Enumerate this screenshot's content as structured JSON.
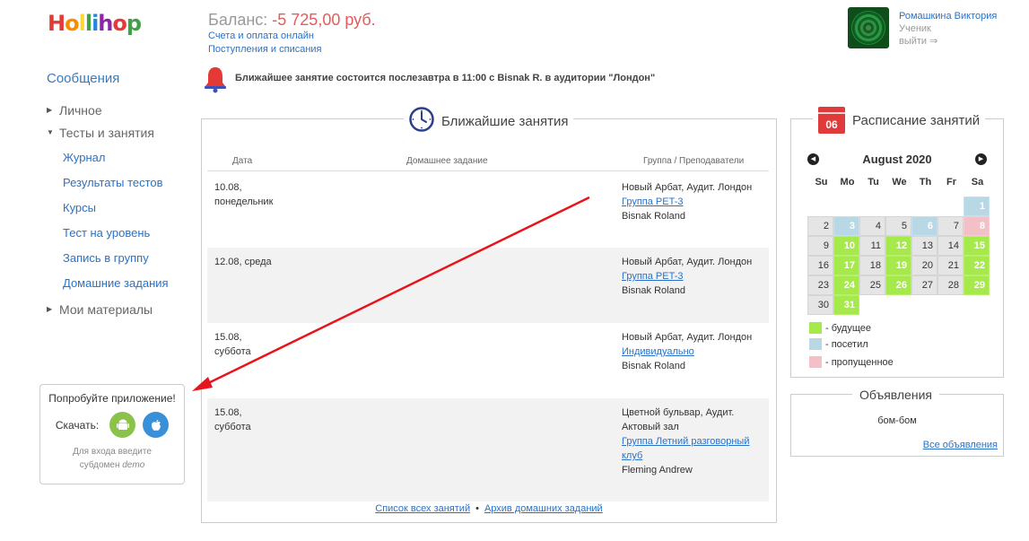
{
  "logo": {
    "letters": [
      "H",
      "o",
      "l",
      "l",
      "i",
      "h",
      "o",
      "p"
    ],
    "colors": [
      "#e53935",
      "#fb8c00",
      "#fdd835",
      "#43a047",
      "#1e88e5",
      "#8e24aa",
      "#e53935",
      "#43a047"
    ]
  },
  "balance": {
    "label": "Баланс: ",
    "value": "-5 725,00 руб.",
    "link1": "Счета и оплата онлайн",
    "link2": "Поступления и списания"
  },
  "user": {
    "name": "Ромашкина Виктория",
    "role": "Ученик",
    "logout": "выйти ⇒"
  },
  "nav": {
    "header": "Сообщения",
    "personal": "Личное",
    "tests": "Тесты и занятия",
    "items": [
      "Журнал",
      "Результаты тестов",
      "Курсы",
      "Тест на уровень",
      "Запись в группу",
      "Домашние задания"
    ],
    "materials": "Мои материалы"
  },
  "app": {
    "title": "Попробуйте приложение!",
    "download": "Скачать:",
    "note1": "Для входа введите",
    "note2": "субдомен",
    "note_em": "demo"
  },
  "notice": "Ближайшее занятие состоится послезавтра в 11:00 с Bisnak R. в аудитории \"Лондон\"",
  "lessons": {
    "title": "Ближайшие занятия",
    "col_date": "Дата",
    "col_homework": "Домашнее задание",
    "col_group": "Группа / Преподаватели",
    "rows": [
      {
        "date1": "10.08,",
        "date2": "понедельник",
        "place": "Новый Арбат, Аудит. Лондон",
        "group": "Группа PET-3",
        "teacher": "Bisnak Roland"
      },
      {
        "date1": "12.08, среда",
        "date2": "",
        "place": "Новый Арбат, Аудит. Лондон",
        "group": "Группа PET-3",
        "teacher": "Bisnak Roland"
      },
      {
        "date1": "15.08,",
        "date2": "суббота",
        "place": "Новый Арбат, Аудит. Лондон",
        "group": "Индивидуально",
        "teacher": "Bisnak Roland"
      },
      {
        "date1": "15.08,",
        "date2": "суббота",
        "place": "Цветной бульвар, Аудит. Актовый зал",
        "group": "Группа Летний разговорный клуб",
        "teacher": "Fleming Andrew"
      }
    ],
    "all_link": "Список всех занятий",
    "sep": "•",
    "archive_link": "Архив домашних заданий"
  },
  "schedule": {
    "title": "Расписание занятий",
    "icon_day": "06",
    "month": "August 2020",
    "weekdays": [
      "Su",
      "Mo",
      "Tu",
      "We",
      "Th",
      "Fr",
      "Sa"
    ],
    "lead_empty": 6,
    "days": 31,
    "future": [
      10,
      12,
      15,
      17,
      19,
      22,
      24,
      26,
      29,
      31
    ],
    "visited": [
      1,
      3,
      6
    ],
    "missed": [
      8
    ],
    "past_until": 30,
    "legend_future": "- будущее",
    "legend_visited": "- посетил",
    "legend_missed": "- пропущенное",
    "colors": {
      "future": "#a5e94a",
      "visited": "#b9d8e6",
      "missed": "#f3c0c8"
    }
  },
  "announcements": {
    "title": "Объявления",
    "body": "бом-бом",
    "all": "Все объявления"
  }
}
